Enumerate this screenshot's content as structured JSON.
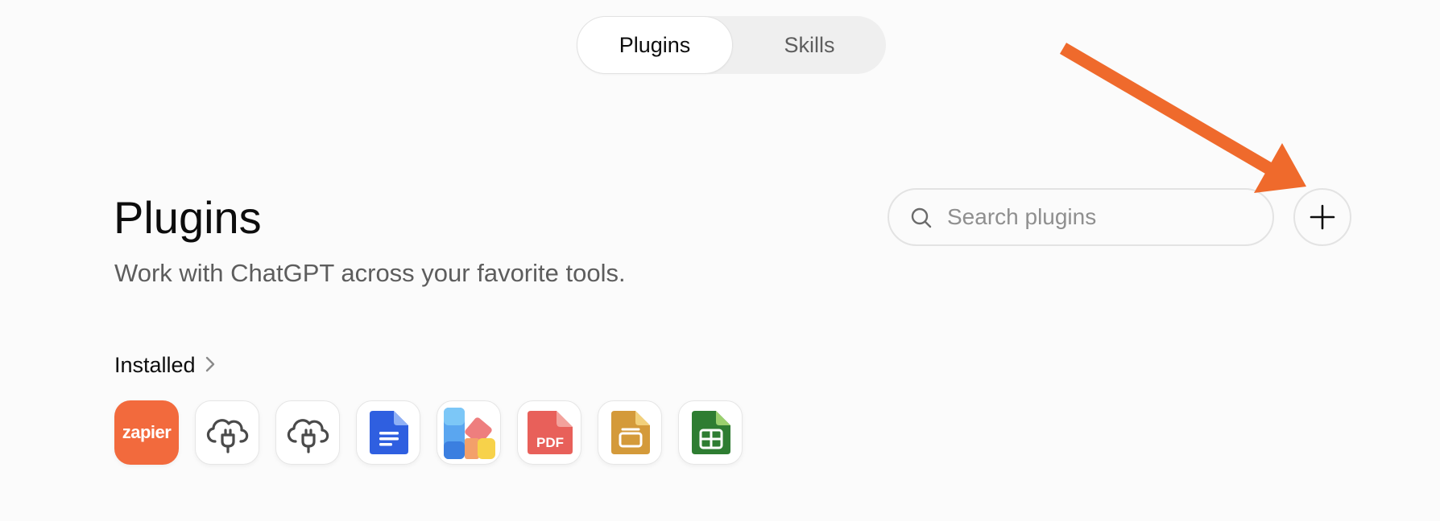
{
  "tabs": {
    "plugins": "Plugins",
    "skills": "Skills"
  },
  "header": {
    "title": "Plugins",
    "subtitle": "Work with ChatGPT across your favorite tools."
  },
  "search": {
    "placeholder": "Search plugins",
    "value": ""
  },
  "installed": {
    "label": "Installed",
    "items": [
      {
        "icon": "zapier-icon",
        "label": "zapier",
        "color": "#f26a3d"
      },
      {
        "icon": "cloud-plug-icon"
      },
      {
        "icon": "cloud-plug-icon"
      },
      {
        "icon": "google-docs-icon",
        "color": "#2f5fe0"
      },
      {
        "icon": "color-blocks-icon"
      },
      {
        "icon": "pdf-icon",
        "label": "PDF",
        "color": "#e8605a"
      },
      {
        "icon": "slides-icon",
        "color": "#d49a3a"
      },
      {
        "icon": "sheets-icon",
        "color": "#2e7d32"
      }
    ]
  },
  "annotation": {
    "arrow_color": "#ef6a2c"
  },
  "colors": {
    "background": "#fbfbfb",
    "text_primary": "#0d0d0d",
    "text_secondary": "#5d5d5d",
    "border": "#e3e3e3"
  }
}
